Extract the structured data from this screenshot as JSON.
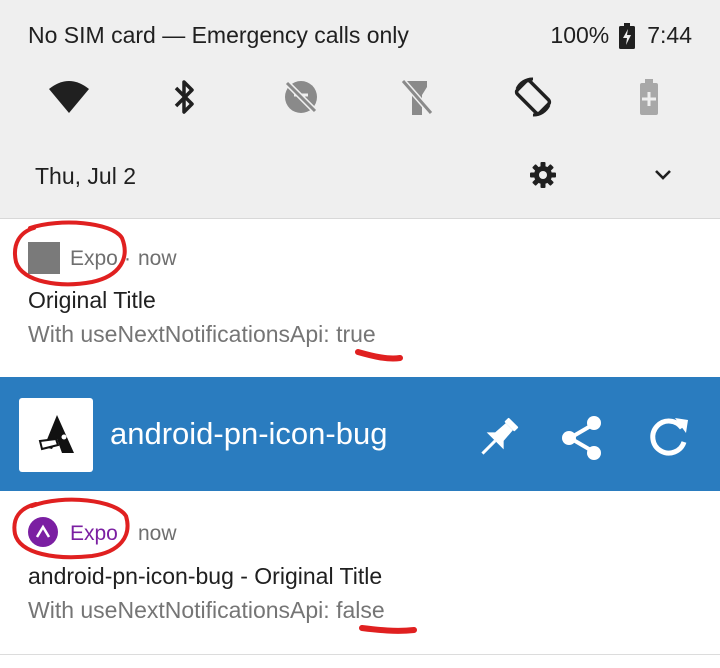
{
  "status_bar": {
    "carrier_text": "No SIM card — Emergency calls only",
    "battery": "100%",
    "time": "7:44"
  },
  "quick_settings": {
    "tiles": [
      "wifi-icon",
      "bluetooth-icon",
      "data-saver-off-icon",
      "flashlight-off-icon",
      "auto-rotate-icon",
      "battery-saver-icon"
    ],
    "date": "Thu, Jul 2"
  },
  "notification_1": {
    "app_name": "Expo",
    "separator": "·",
    "time": "now",
    "title": "Original Title",
    "body": "With useNextNotificationsApi: true"
  },
  "app_banner": {
    "title": "android-pn-icon-bug",
    "accent": "#2a7cbf"
  },
  "notification_2": {
    "app_name": "Expo",
    "time": "now",
    "title": "android-pn-icon-bug - Original Title",
    "body": "With useNextNotificationsApi: false",
    "accent": "#7b1fa2"
  },
  "annotation_color": "#e02020"
}
